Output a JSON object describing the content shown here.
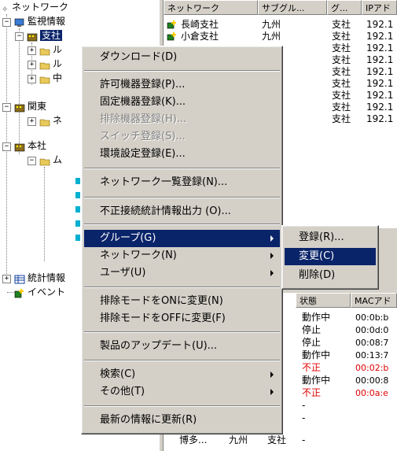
{
  "tree": {
    "root": "ネットワーク",
    "monitor": "監視情報",
    "branch": "支社",
    "kanto": "関東",
    "honsha": "本社",
    "stats": "統計情報",
    "event": "イベント",
    "branch_children_partial": [
      "ル",
      "ル",
      "中"
    ],
    "kanto_child_partial": "ネ",
    "honsha_child_partial": "ム"
  },
  "list_top": {
    "headers": [
      "ネットワーク",
      "サブグル...",
      "グ...",
      "IPアド"
    ],
    "rows": [
      [
        "長崎支社",
        "九州",
        "支社",
        "192.1"
      ],
      [
        "小倉支社",
        "九州",
        "支社",
        "192.1"
      ],
      [
        "",
        "",
        "支社",
        "192.1"
      ],
      [
        "",
        "",
        "支社",
        "192.1"
      ],
      [
        "",
        "",
        "支社",
        "192.1"
      ],
      [
        "",
        "",
        "支社",
        "192.1"
      ],
      [
        "",
        "",
        "支社",
        "192.1"
      ],
      [
        "",
        "",
        "支社",
        "192.1"
      ],
      [
        "",
        "",
        "支社",
        "192.1"
      ]
    ]
  },
  "list_bot": {
    "headers": [
      "状態",
      "MACアド"
    ],
    "rows": [
      {
        "status": "動作中",
        "mac": "00:0b:b",
        "red": false
      },
      {
        "status": "停止",
        "mac": "00:0d:0",
        "red": false
      },
      {
        "status": "停止",
        "mac": "00:08:7",
        "red": false
      },
      {
        "status": "動作中",
        "mac": "00:13:7",
        "red": false
      },
      {
        "status": "不正",
        "mac": "00:02:b",
        "red": true
      },
      {
        "status": "動作中",
        "mac": "00:00:8",
        "red": false
      },
      {
        "status": "不正",
        "mac": "00:0a:e",
        "red": true
      },
      {
        "status": "-",
        "mac": "",
        "red": false
      },
      {
        "status": "-",
        "mac": "",
        "red": false
      }
    ],
    "last_row": {
      "name": "博多...",
      "sub": "九州",
      "group": "支社",
      "status": "-"
    }
  },
  "context_menu": {
    "items": [
      {
        "label": "ダウンロード(D)",
        "disabled": false
      },
      {
        "label": "許可機器登録(P)...",
        "disabled": false
      },
      {
        "label": "固定機器登録(K)...",
        "disabled": false
      },
      {
        "label": "排除機器登録(H)...",
        "disabled": true
      },
      {
        "label": "スイッチ登録(S)...",
        "disabled": true
      },
      {
        "label": "環境設定登録(E)...",
        "disabled": false
      },
      {
        "label": "ネットワーク一覧登録(N)...",
        "disabled": false
      },
      {
        "label": "不正接続統計情報出力 (O)...",
        "disabled": false
      },
      {
        "label": "グループ(G)",
        "disabled": false,
        "submenu": true,
        "highlighted": true
      },
      {
        "label": "ネットワーク(N)",
        "disabled": false,
        "submenu": true
      },
      {
        "label": "ユーザ(U)",
        "disabled": false,
        "submenu": true
      },
      {
        "label": "排除モードをONに変更(N)",
        "disabled": false
      },
      {
        "label": "排除モードをOFFに変更(F)",
        "disabled": false
      },
      {
        "label": "製品のアップデート(U)...",
        "disabled": false
      },
      {
        "label": "検索(C)",
        "disabled": false,
        "submenu": true
      },
      {
        "label": "その他(T)",
        "disabled": false,
        "submenu": true
      },
      {
        "label": "最新の情報に更新(R)",
        "disabled": false
      }
    ]
  },
  "submenu": {
    "items": [
      {
        "label": "登録(R)..."
      },
      {
        "label": "変更(C)",
        "highlighted": true
      },
      {
        "label": "削除(D)"
      }
    ]
  },
  "colors": {
    "highlight": "#0a246a",
    "face": "#d4d0c8",
    "alert": "#e00000"
  }
}
